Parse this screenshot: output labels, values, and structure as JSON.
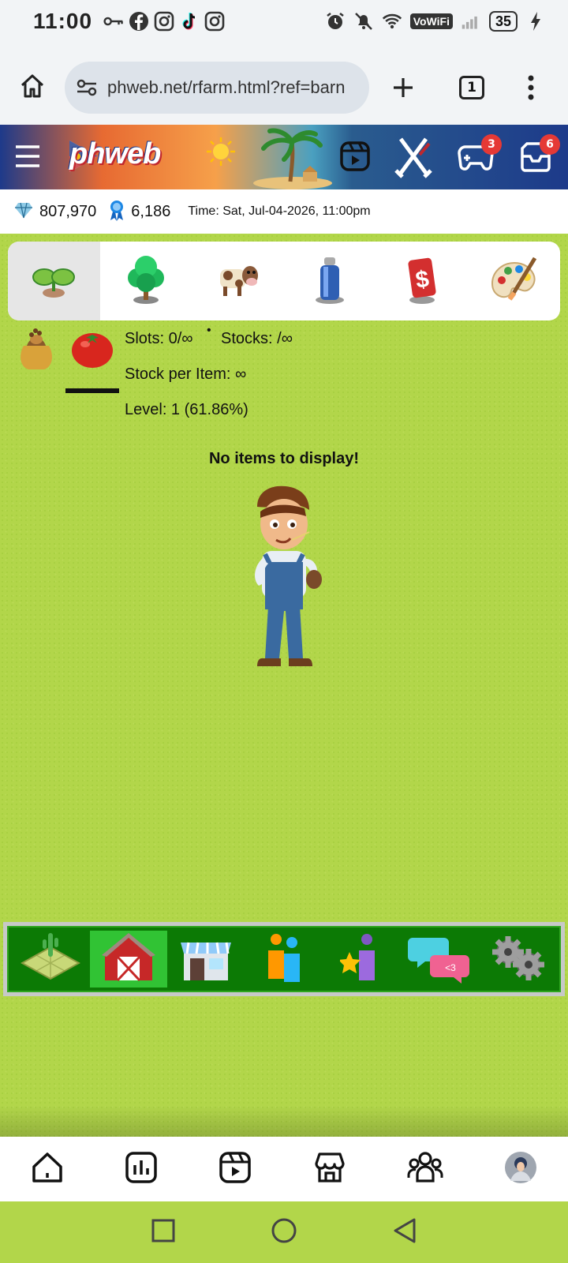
{
  "status_bar": {
    "time": "11:00",
    "left_icons": [
      "key-icon",
      "facebook-icon",
      "instagram-icon",
      "tiktok-icon",
      "instagram-icon"
    ],
    "right_icons": [
      "alarm-icon",
      "mute-icon",
      "wifi-icon",
      "vowifi-icon",
      "signal-icon",
      "battery-icon",
      "charging-icon"
    ],
    "vowifi_label": "VoWiFi",
    "battery": "35"
  },
  "browser": {
    "url": "phweb.net/rfarm.html?ref=barn",
    "tab_count": "1",
    "icons": [
      "home-icon",
      "site-info-icon",
      "new-tab-icon",
      "tabs-icon",
      "more-icon"
    ]
  },
  "site_header": {
    "logo": "phweb",
    "icons": [
      "menu-icon",
      "reels-icon",
      "battle-icon",
      "games-icon",
      "inbox-icon"
    ],
    "games_badge": "3",
    "inbox_badge": "6"
  },
  "stats": {
    "diamonds": "807,970",
    "medals": "6,186",
    "time_text": "Time: Sat, Jul-04-2026, 11:00pm"
  },
  "category_tabs": [
    "sprout-icon",
    "tree-icon",
    "cow-icon",
    "spray-can-icon",
    "dollar-icon",
    "palette-icon"
  ],
  "info": {
    "slots": "Slots: 0/∞",
    "stocks": "Stocks: /∞",
    "stock_per_item": "Stock per Item: ∞",
    "level": "Level: 1 (61.86%)",
    "empty_message": "No items to display!"
  },
  "bottom_nav": [
    "farm-field-icon",
    "barn-icon",
    "shop-icon",
    "friends-icon",
    "achievements-icon",
    "chat-icon",
    "settings-icon"
  ],
  "app_nav": [
    "home-icon",
    "stats-icon",
    "reels-icon",
    "store-icon",
    "groups-icon",
    "profile-avatar"
  ],
  "system_nav": [
    "recents-icon",
    "home-circle-icon",
    "back-icon"
  ],
  "colors": {
    "grass": "#b2d64a",
    "nav_green": "#0c7a05",
    "nav_active": "#31c334",
    "badge_red": "#e53935"
  }
}
